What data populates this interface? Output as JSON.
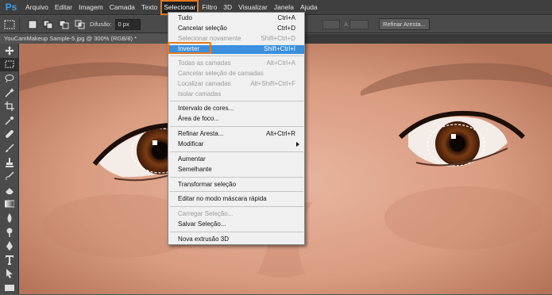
{
  "app": {
    "logo": "Ps",
    "accent": "#e3791e",
    "highlight": "#3a8fde"
  },
  "menubar": {
    "items": [
      "Arquivo",
      "Editar",
      "Imagem",
      "Camada",
      "Texto",
      "Selecionar",
      "Filtro",
      "3D",
      "Visualizar",
      "Janela",
      "Ajuda"
    ],
    "active": "Selecionar"
  },
  "options": {
    "feather_label": "Difusão:",
    "feather_value": "0 px",
    "refine_button": "Refinar Aresta...",
    "height_label": "A:"
  },
  "document": {
    "tab_title": "YouCamMakeup Sample-5.jpg @ 300% (RGB/8) *"
  },
  "select_menu": {
    "items": [
      {
        "label": "Tudo",
        "shortcut": "Ctrl+A",
        "disabled": false
      },
      {
        "label": "Cancelar seleção",
        "shortcut": "Ctrl+D",
        "disabled": false
      },
      {
        "label": "Selecionar novamente",
        "shortcut": "Shift+Ctrl+D",
        "disabled": true
      },
      {
        "label": "Inverter",
        "shortcut": "Shift+Ctrl+I",
        "disabled": false,
        "highlighted": true
      },
      {
        "label": "Todas as camadas",
        "shortcut": "Alt+Ctrl+A",
        "disabled": true
      },
      {
        "label": "Cancelar seleção de camadas",
        "shortcut": "",
        "disabled": true
      },
      {
        "label": "Localizar camadas",
        "shortcut": "Alt+Shift+Ctrl+F",
        "disabled": true
      },
      {
        "label": "Isolar camadas",
        "shortcut": "",
        "disabled": true
      },
      {
        "label": "Intervalo de cores...",
        "shortcut": "",
        "disabled": false
      },
      {
        "label": "Área de foco...",
        "shortcut": "",
        "disabled": false
      },
      {
        "label": "Refinar Aresta...",
        "shortcut": "Alt+Ctrl+R",
        "disabled": false
      },
      {
        "label": "Modificar",
        "shortcut": "",
        "disabled": false,
        "submenu": true
      },
      {
        "label": "Aumentar",
        "shortcut": "",
        "disabled": false
      },
      {
        "label": "Semelhante",
        "shortcut": "",
        "disabled": false
      },
      {
        "label": "Transformar seleção",
        "shortcut": "",
        "disabled": false
      },
      {
        "label": "Editar no modo máscara rápida",
        "shortcut": "",
        "disabled": false
      },
      {
        "label": "Carregar Seleção...",
        "shortcut": "",
        "disabled": true
      },
      {
        "label": "Salvar Seleção...",
        "shortcut": "",
        "disabled": false
      },
      {
        "label": "Nova extrusão 3D",
        "shortcut": "",
        "disabled": false
      }
    ]
  }
}
